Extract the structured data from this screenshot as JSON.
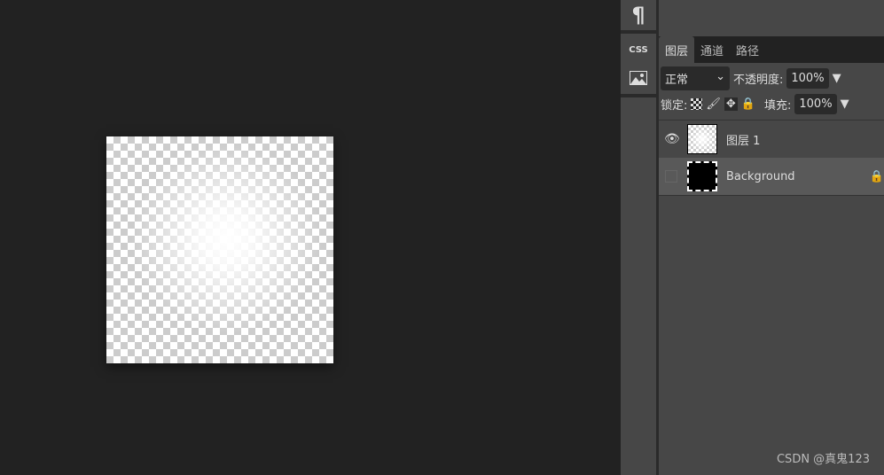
{
  "toolstrip": {
    "items": [
      {
        "icon": "paragraph-icon",
        "glyph": "¶"
      },
      {
        "icon": "css-icon",
        "glyph": "CSS"
      },
      {
        "icon": "image-icon",
        "glyph": "🏔"
      }
    ]
  },
  "panel": {
    "tabs": [
      {
        "label": "图层",
        "active": true
      },
      {
        "label": "通道"
      },
      {
        "label": "路径"
      }
    ],
    "blend_mode": "正常",
    "opacity_label": "不透明度:",
    "opacity_value": "100%",
    "lock_label": "锁定:",
    "fill_label": "填充:",
    "fill_value": "100%",
    "layers": [
      {
        "name": "图层 1",
        "visible": true
      },
      {
        "name": "Background",
        "visible": false,
        "locked": true
      }
    ]
  },
  "watermark": "CSDN @真鬼123"
}
